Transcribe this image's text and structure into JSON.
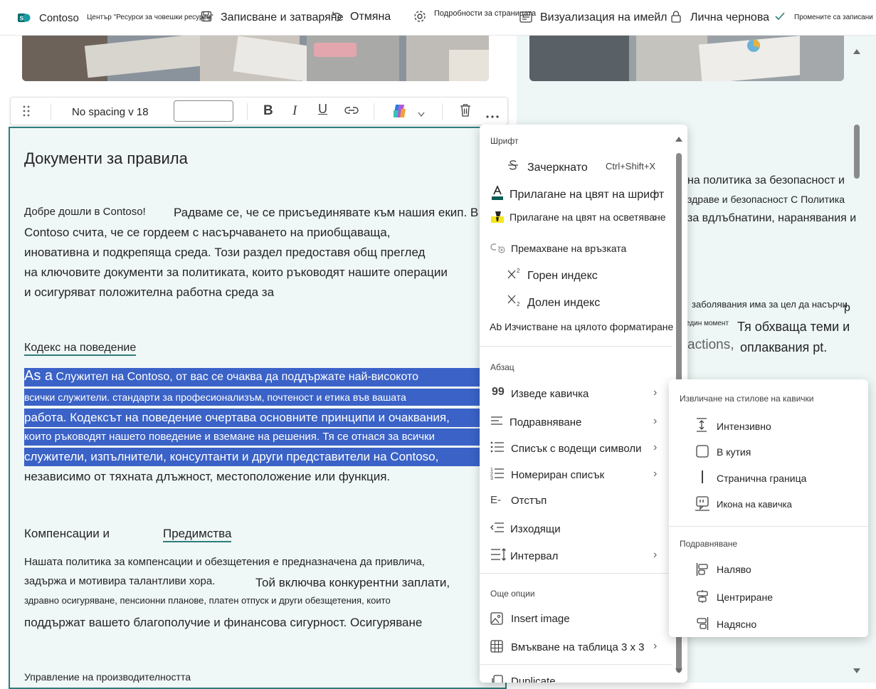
{
  "topbar": {
    "site_name": "Contoso",
    "hub_name": "Център \"Ресурси за човешки ресурси\"",
    "save_close": "Записване и затваряне",
    "undo": "Отмяна",
    "page_details": "Подробности за страницата",
    "email_preview": "Визуализация на имейл",
    "private_draft": "Лична чернова",
    "changes_saved": "Промените са записани"
  },
  "toolbar": {
    "style_label": "No spacing v 18"
  },
  "content": {
    "heading": "Документи за правила",
    "intro_1": "Добре дошли в Contoso!",
    "intro_2": "Радваме се, че се присъединявате към нашия екип. В",
    "intro_3": "Contoso считa, че се гордеем с насърчаването на приобщаваща,",
    "intro_4": "иновативна и подкрепяща среда. Този раздел предоставя общ преглед",
    "intro_5": "на ключовите документи за политиката, които ръководят нашите операции",
    "intro_6": "и осигуряват положителна работна среда за",
    "conduct_heading": "Кодекс на поведение",
    "conduct_1a": "As a",
    "conduct_1b": " Служител на Contoso, от вас се очаква да поддържате най-високото",
    "conduct_2": "всички служители. стандарти за професионализъм, почтеност и етика във вашата",
    "conduct_3": "работа. Кодексът на поведение очертава основните принципи и очаквания,",
    "conduct_4": "които ръководят нашето поведение и вземане на решения. Тя се отнася за всички",
    "conduct_5": "служители, изпълнители, консултанти и други представители на Contoso,",
    "conduct_6": "независимо от тяхната длъжност, местоположение или функция.",
    "comp_heading_1": "Компенсации и",
    "comp_heading_2": "Предимства",
    "comp_1": "Нашата политика за компенсации и обезщетения е предназначена да привлича,",
    "comp_2": "задържа и мотивира талантливи хора.",
    "comp_3": "Той включва конкурентни заплати,",
    "comp_4": "здравно осигуряване, пенсионни планове, платен отпуск и други обезщетения, които",
    "comp_5": "поддържат вашето благополучие и финансова сигурност. Осигуряване",
    "perf_heading": "Управление на производителността"
  },
  "right_content": {
    "line_1": "на политика за безопасност и",
    "line_2": "здраве и безопасност С Политика",
    "line_3": "за вдлъбнатини, наранявания и",
    "line_4": "заболявания има за цел да насърчи",
    "line_4b": "р",
    "line_5a": "един момент",
    "line_5b": "Тя обхваща теми и",
    "line_6a": "actions,",
    "line_6b": "оплаквания pt."
  },
  "menu": {
    "font_header": "Шрифт",
    "strikethrough": "Зачеркнато",
    "strikethrough_shortcut": "Ctrl+Shift+X",
    "font_color": "Прилагане на цвят на шрифт",
    "highlight_color": "Прилагане на цвят на осветяване",
    "remove_link": "Премахване на връзката",
    "superscript": "Горен индекс",
    "subscript": "Долен индекс",
    "clear_formatting": "Ab Изчистване на цялото форматиране",
    "paragraph_header": "Абзац",
    "pull_quote": "Изведе кавичка",
    "alignment": "Подравняване",
    "bullets": "Списък с водещи символи",
    "numbered": "Номериран списък",
    "indent": "Отстъп",
    "outdent": "Изходящи",
    "spacing": "Интервал",
    "more_header": "Още опции",
    "insert_image": "Insert image",
    "insert_table": "Вмъкване на таблица 3 x 3",
    "duplicate": "Duplicate"
  },
  "submenu": {
    "styles_header": "Извличане на стилове на кавички",
    "intense": "Интензивно",
    "boxed": "В кутия",
    "page_border": "Странична граница",
    "quote_icon": "Икона на кавичка",
    "align_header": "Подравняване",
    "left": "Наляво",
    "center": "Центриране",
    "right": "Надясно"
  },
  "colors": {
    "accent_teal": "#2f7d7a",
    "selection_blue": "#3a62c7",
    "font_color_bar": "#0b5c54",
    "highlight_yellow": "#f7e51b"
  }
}
